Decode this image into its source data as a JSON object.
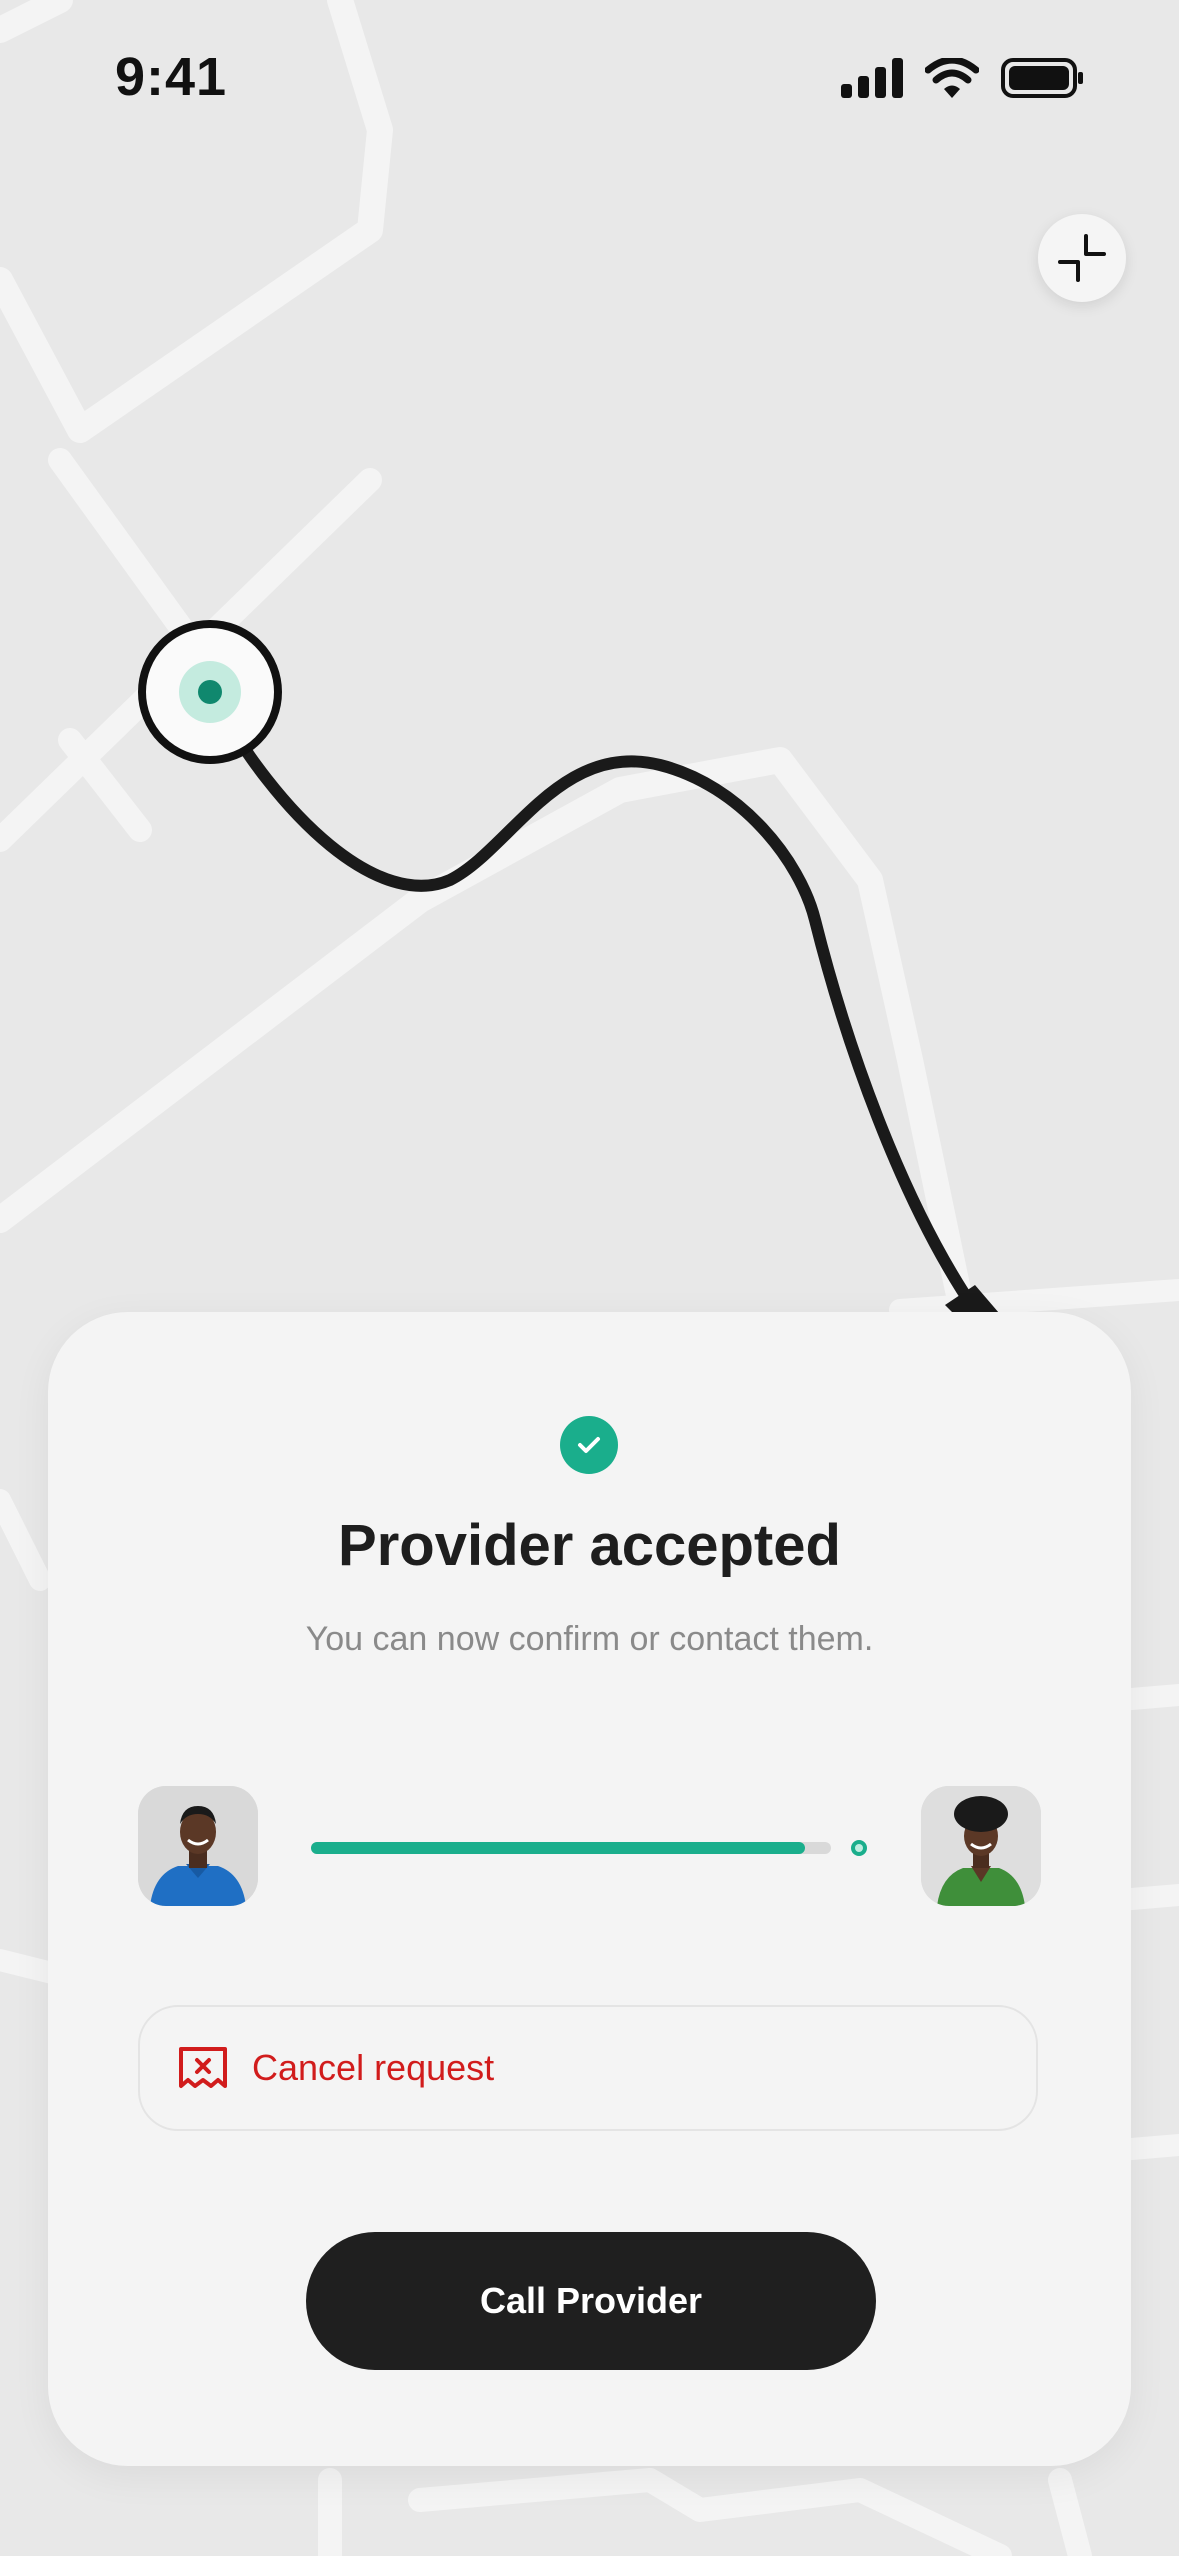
{
  "status_bar": {
    "time": "9:41"
  },
  "sheet": {
    "title": "Provider accepted",
    "subtitle": "You can now confirm or contact them.",
    "progress": 0.95,
    "cancel_label": "Cancel request",
    "call_label": "Call Provider"
  },
  "colors": {
    "accent": "#1aae8c",
    "danger": "#d11c1c",
    "button": "#1f1f1f"
  },
  "icons": [
    "signal-icon",
    "wifi-icon",
    "battery-icon",
    "collapse-icon",
    "check-icon",
    "cancel-receipt-icon"
  ]
}
